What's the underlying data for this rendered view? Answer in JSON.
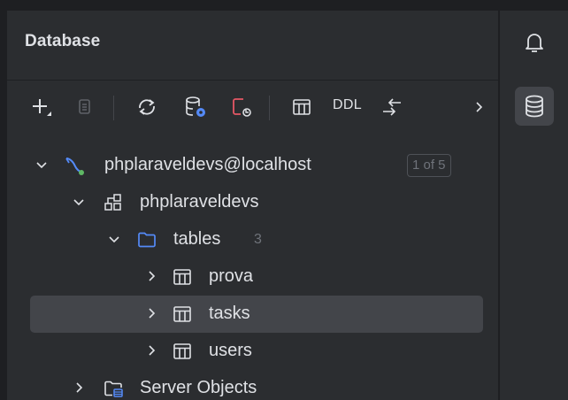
{
  "panel": {
    "title": "Database"
  },
  "toolbar": {
    "items": [
      {
        "name": "new-icon",
        "label": "New"
      },
      {
        "name": "duplicate-icon",
        "label": "Duplicate"
      },
      {
        "name": "refresh-icon",
        "label": "Refresh"
      },
      {
        "name": "data-source-properties-icon",
        "label": "Data Source Properties"
      },
      {
        "name": "disconnect-icon",
        "label": "Disconnect"
      },
      {
        "name": "table-editor-icon",
        "label": "Table Editor"
      },
      {
        "name": "jump-to-console-icon",
        "label": "Jump to Console"
      },
      {
        "name": "more-chevron-icon",
        "label": "More"
      }
    ],
    "ddl_label": "DDL"
  },
  "tree": {
    "connection": {
      "label": "phplaraveldevs@localhost",
      "badge": "1 of 5",
      "icon": "mysql-dolphin-icon",
      "expanded": true
    },
    "schema": {
      "label": "phplaraveldevs",
      "icon": "schema-icon",
      "expanded": true
    },
    "tables_folder": {
      "label": "tables",
      "count": "3",
      "icon": "folder-icon",
      "expanded": true
    },
    "tables": [
      {
        "label": "prova",
        "selected": false
      },
      {
        "label": "tasks",
        "selected": true
      },
      {
        "label": "users",
        "selected": false
      }
    ],
    "server_objects": {
      "label": "Server Objects",
      "icon": "server-objects-icon",
      "expanded": false
    }
  },
  "right_bar": {
    "notifications_icon": "bell-icon",
    "database_icon": "database-icon",
    "active": "database"
  },
  "colors": {
    "background": "#2b2d30",
    "selection": "#43454a",
    "text": "#dfe1e5",
    "muted": "#6f737a",
    "folder_accent": "#548af7",
    "disconnect_accent": "#e55765"
  }
}
